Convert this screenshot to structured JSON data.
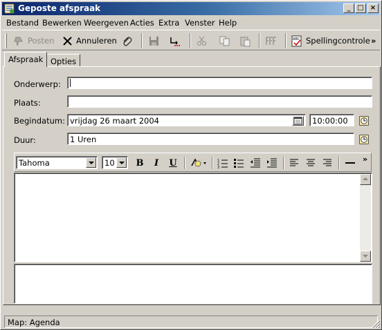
{
  "window": {
    "title": "Geposte afspraak"
  },
  "titlebar_buttons": {
    "minimize": "_",
    "maximize": "□",
    "close": "×"
  },
  "menu": [
    "Bestand",
    "Bewerken",
    "Weergeven",
    "Acties",
    "Extra",
    "Venster",
    "Help"
  ],
  "toolbar": {
    "post_label": "Posten",
    "cancel_label": "Annuleren",
    "spelling_label": "Spellingcontrole",
    "overflow": "»"
  },
  "tabs": [
    "Afspraak",
    "Opties"
  ],
  "form": {
    "subject_label": "Onderwerp:",
    "subject_value": "",
    "location_label": "Plaats:",
    "location_value": "",
    "start_label": "Begindatum:",
    "start_date": "vrijdag 26 maart 2004",
    "start_time": "10:00:00",
    "duration_label": "Duur:",
    "duration_value": "1 Uren"
  },
  "format_toolbar": {
    "font": "Tahoma",
    "size": "10",
    "bold": "B",
    "italic": "I",
    "underline": "U",
    "overflow": "»"
  },
  "status": {
    "folder": "Map: Agenda"
  },
  "colors": {
    "title_start": "#0a246a",
    "title_end": "#a6caf0",
    "face": "#d4d0c8"
  }
}
